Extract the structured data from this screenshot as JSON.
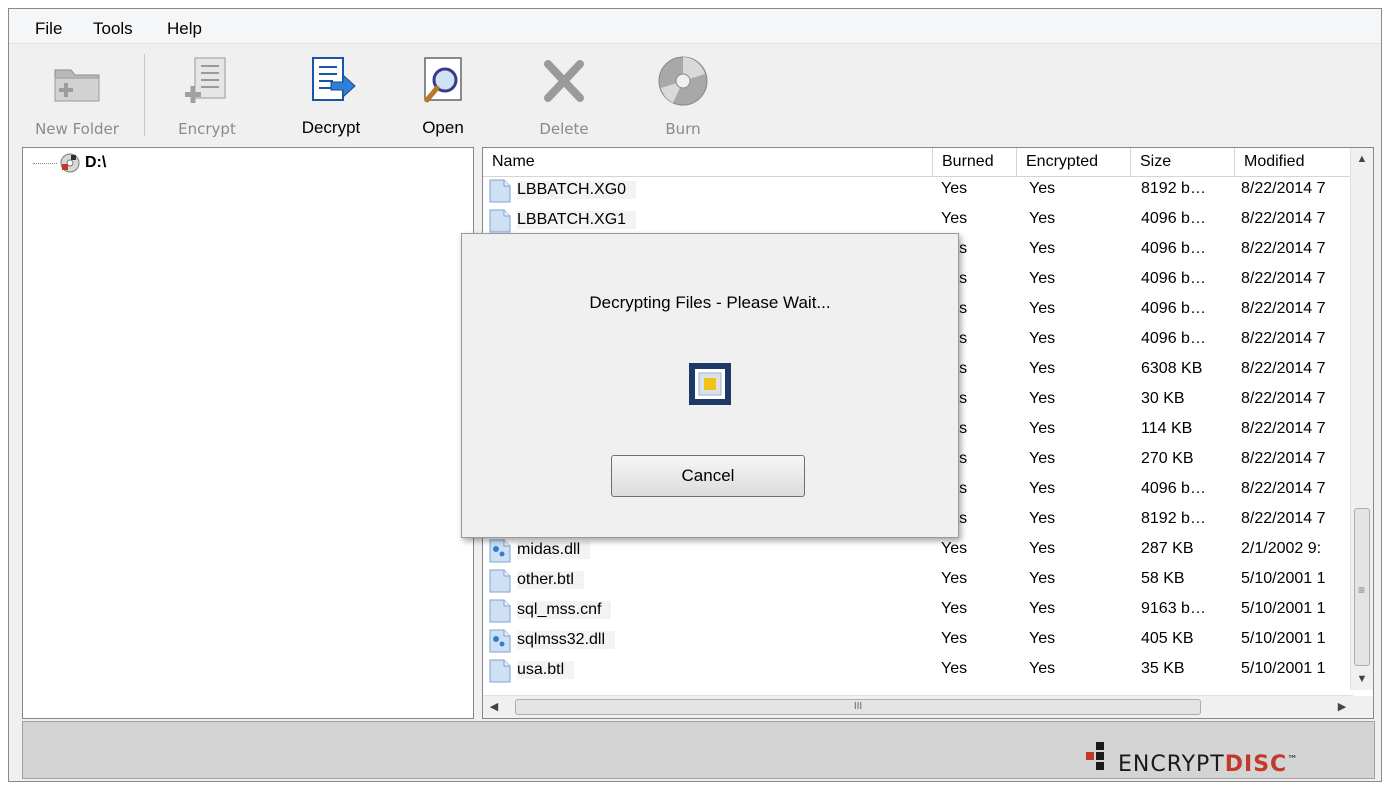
{
  "menu": {
    "items": [
      "File",
      "Tools",
      "Help"
    ]
  },
  "toolbar": {
    "new_folder": "New Folder",
    "encrypt": "Encrypt",
    "decrypt": "Decrypt",
    "open": "Open",
    "delete": "Delete",
    "burn": "Burn"
  },
  "tree": {
    "root_label": "D:\\"
  },
  "list": {
    "columns": [
      "Name",
      "Burned",
      "Encrypted",
      "Size",
      "Modified"
    ],
    "rows": [
      {
        "name": "LBBATCH.XG0",
        "burned": "Yes",
        "encrypted": "Yes",
        "size": "8192 b…",
        "modified": "8/22/2014 7",
        "icon": "file-icon"
      },
      {
        "name": "LBBATCH.XG1",
        "burned": "Yes",
        "encrypted": "Yes",
        "size": "4096 b…",
        "modified": "8/22/2014 7",
        "icon": "file-icon"
      },
      {
        "name": "",
        "burned": "Yes",
        "encrypted": "Yes",
        "size": "4096 b…",
        "modified": "8/22/2014 7",
        "icon": "file-icon"
      },
      {
        "name": "",
        "burned": "Yes",
        "encrypted": "Yes",
        "size": "4096 b…",
        "modified": "8/22/2014 7",
        "icon": "file-icon"
      },
      {
        "name": "",
        "burned": "Yes",
        "encrypted": "Yes",
        "size": "4096 b…",
        "modified": "8/22/2014 7",
        "icon": "file-icon"
      },
      {
        "name": "",
        "burned": "Yes",
        "encrypted": "Yes",
        "size": "4096 b…",
        "modified": "8/22/2014 7",
        "icon": "file-icon"
      },
      {
        "name": "",
        "burned": "Yes",
        "encrypted": "Yes",
        "size": "6308 KB",
        "modified": "8/22/2014 7",
        "icon": "file-icon"
      },
      {
        "name": "",
        "burned": "Yes",
        "encrypted": "Yes",
        "size": "30 KB",
        "modified": "8/22/2014 7",
        "icon": "file-icon"
      },
      {
        "name": "",
        "burned": "Yes",
        "encrypted": "Yes",
        "size": "114 KB",
        "modified": "8/22/2014 7",
        "icon": "file-icon"
      },
      {
        "name": "",
        "burned": "Yes",
        "encrypted": "Yes",
        "size": "270 KB",
        "modified": "8/22/2014 7",
        "icon": "file-icon"
      },
      {
        "name": "",
        "burned": "Yes",
        "encrypted": "Yes",
        "size": "4096 b…",
        "modified": "8/22/2014 7",
        "icon": "file-icon"
      },
      {
        "name": "",
        "burned": "Yes",
        "encrypted": "Yes",
        "size": "8192 b…",
        "modified": "8/22/2014 7",
        "icon": "file-icon"
      },
      {
        "name": "midas.dll",
        "burned": "Yes",
        "encrypted": "Yes",
        "size": "287 KB",
        "modified": "2/1/2002 9:",
        "icon": "dll-icon"
      },
      {
        "name": "other.btl",
        "burned": "Yes",
        "encrypted": "Yes",
        "size": "58 KB",
        "modified": "5/10/2001 1",
        "icon": "file-icon"
      },
      {
        "name": "sql_mss.cnf",
        "burned": "Yes",
        "encrypted": "Yes",
        "size": "9163 b…",
        "modified": "5/10/2001 1",
        "icon": "file-icon"
      },
      {
        "name": "sqlmss32.dll",
        "burned": "Yes",
        "encrypted": "Yes",
        "size": "405 KB",
        "modified": "5/10/2001 1",
        "icon": "dll-icon"
      },
      {
        "name": "usa.btl",
        "burned": "Yes",
        "encrypted": "Yes",
        "size": "35 KB",
        "modified": "5/10/2001 1",
        "icon": "file-icon"
      }
    ],
    "hscroll_grip": "III"
  },
  "logo": {
    "part1": "ENCRYPT",
    "part2": "DISC",
    "tm": "™"
  },
  "dialog": {
    "message": "Decrypting Files - Please Wait...",
    "cancel_label": "Cancel"
  },
  "colors": {
    "accent_blue": "#1a56a8",
    "logo_red": "#c0392b",
    "spinner_gold": "#f2c21b"
  }
}
